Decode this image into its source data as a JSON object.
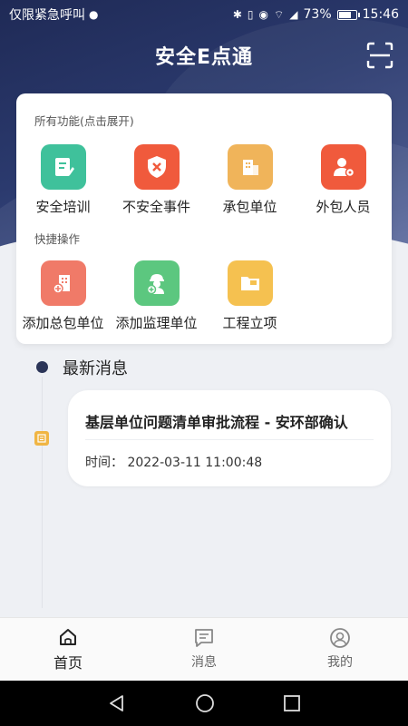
{
  "status_bar": {
    "carrier": "仅限紧急呼叫",
    "battery": "73%",
    "time": "15:46",
    "battery_level": 0.73
  },
  "header": {
    "title": "安全E点通"
  },
  "all_functions": {
    "label": "所有功能(点击展开)",
    "items": [
      {
        "label": "安全培训",
        "icon": "training-icon",
        "color": "#3fc19b"
      },
      {
        "label": "不安全事件",
        "icon": "shield-alert-icon",
        "color": "#f05a3c"
      },
      {
        "label": "承包单位",
        "icon": "building-icon",
        "color": "#f0b45a"
      },
      {
        "label": "外包人员",
        "icon": "person-gear-icon",
        "color": "#f05a3c"
      }
    ]
  },
  "quick_actions": {
    "label": "快捷操作",
    "items": [
      {
        "label": "添加总包单位",
        "icon": "add-building-icon",
        "color": "#f07a68"
      },
      {
        "label": "添加监理单位",
        "icon": "add-supervisor-icon",
        "color": "#5cc77f"
      },
      {
        "label": "工程立项",
        "icon": "folder-icon",
        "color": "#f5c150"
      }
    ]
  },
  "news": {
    "heading": "最新消息",
    "items": [
      {
        "title": "基层单位问题清单审批流程 - 安环部确认",
        "time": "时间： 2022-03-11 11:00:48"
      }
    ]
  },
  "tabs": [
    {
      "label": "首页",
      "icon": "home-icon",
      "active": true
    },
    {
      "label": "消息",
      "icon": "message-icon",
      "active": false
    },
    {
      "label": "我的",
      "icon": "user-icon",
      "active": false
    }
  ]
}
